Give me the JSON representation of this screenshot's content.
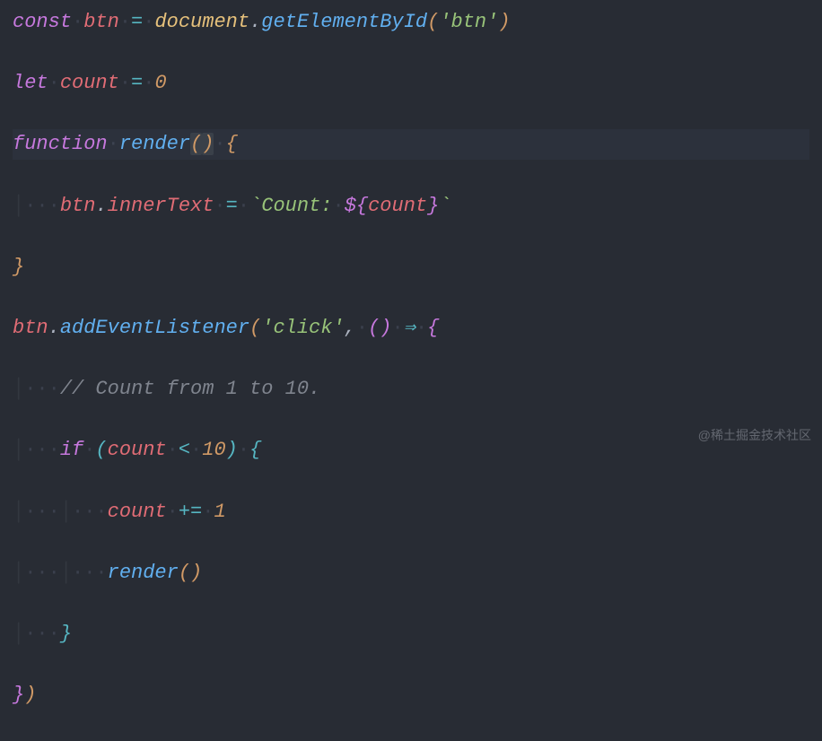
{
  "code": {
    "tokens": {
      "const": "const",
      "let": "let",
      "function": "function",
      "if": "if",
      "btn": "btn",
      "count": "count",
      "document": "document",
      "getElementById": "getElementById",
      "render": "render",
      "innerText": "innerText",
      "addEventListener": "addEventListener",
      "arrow": "⇒",
      "strBtn": "'btn'",
      "strClick": "'click'",
      "backtick": "`",
      "tplCountLabel": "Count:",
      "tplOpen": "${",
      "tplClose": "}",
      "num0": "0",
      "num1": "1",
      "num10": "10",
      "comment": "// Count from 1 to 10.",
      "eq": "=",
      "dot": ".",
      "lt": "<",
      "pluseq": "+=",
      "comma": ",",
      "lparen": "(",
      "rparen": ")",
      "lbrace": "{",
      "rbrace": "}",
      "ws1": "·",
      "guide": "│"
    }
  },
  "watermark": "@稀土掘金技术社区"
}
